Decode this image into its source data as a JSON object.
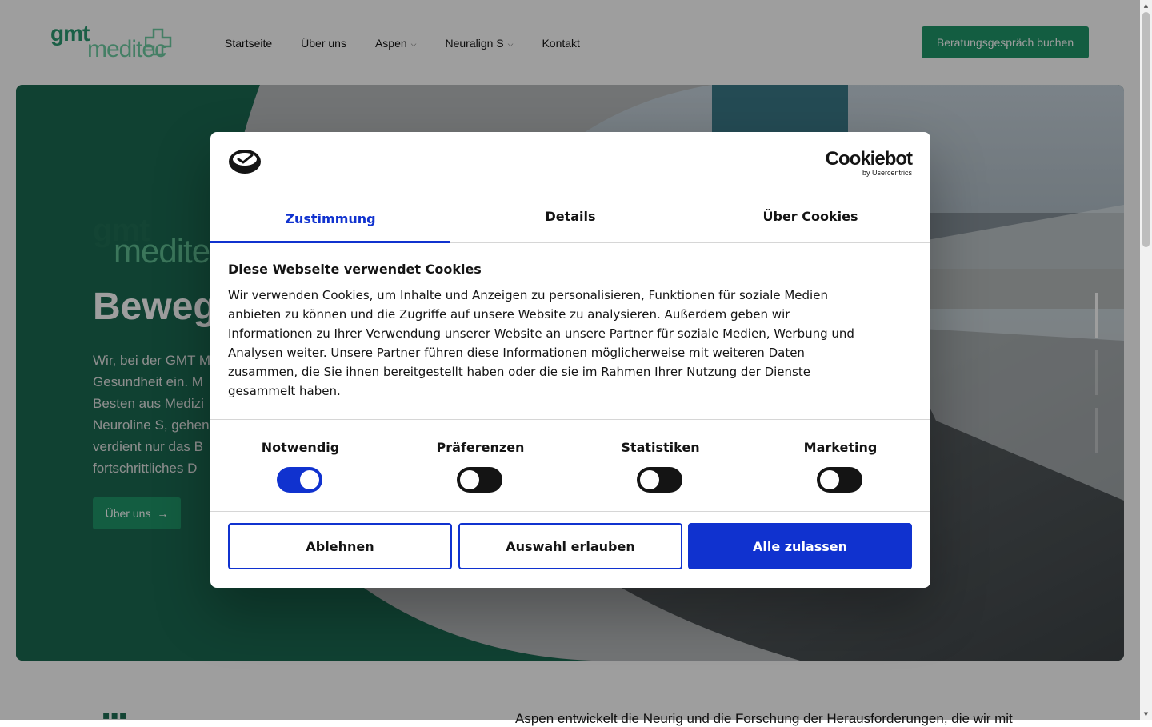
{
  "header": {
    "logo_word1": "gmt",
    "logo_word2": "meditec",
    "nav": [
      {
        "label": "Startseite"
      },
      {
        "label": "Über uns"
      },
      {
        "label": "Aspen",
        "dropdown": true
      },
      {
        "label": "Neuralign S",
        "dropdown": true
      },
      {
        "label": "Kontakt"
      }
    ],
    "cta_label": "Beratungsgespräch buchen"
  },
  "hero": {
    "logo_word1": "gmt",
    "logo_word2": "medite",
    "title": "Beweg",
    "text_lines": [
      "Wir, bei der GMT M",
      "Gesundheit ein. M",
      "Besten aus Medizi",
      "Neuroline S, gehen",
      "verdient nur das B",
      "fortschrittliches D"
    ],
    "button_label": "Über uns",
    "button_arrow": "→",
    "slides": 3,
    "active_slide": 1
  },
  "below": {
    "mark": "▪▪▪",
    "text": "Aspen entwickelt die Neurig und die Forschung der Herausforderungen, die wir mit"
  },
  "cookie_dialog": {
    "brand_name": "Cookiebot",
    "brand_sub": "by Usercentrics",
    "tabs": [
      {
        "label": "Zustimmung",
        "active": true
      },
      {
        "label": "Details",
        "active": false
      },
      {
        "label": "Über Cookies",
        "active": false
      }
    ],
    "heading": "Diese Webseite verwendet Cookies",
    "body_lines": [
      "Wir verwenden Cookies, um Inhalte und Anzeigen zu personalisieren, Funktionen für soziale Medien",
      "anbieten zu können und die Zugriffe auf unsere Website zu analysieren. Außerdem geben wir",
      "Informationen zu Ihrer Verwendung unserer Website an unsere Partner für soziale Medien, Werbung und",
      "Analysen weiter. Unsere Partner führen diese Informationen möglicherweise mit weiteren Daten",
      "zusammen, die Sie ihnen bereitgestellt haben oder die sie im Rahmen Ihrer Nutzung der Dienste",
      "gesammelt haben."
    ],
    "categories": [
      {
        "label": "Notwendig",
        "enabled": true
      },
      {
        "label": "Präferenzen",
        "enabled": false
      },
      {
        "label": "Statistiken",
        "enabled": false
      },
      {
        "label": "Marketing",
        "enabled": false
      }
    ],
    "buttons": {
      "decline": "Ablehnen",
      "allow_selection": "Auswahl erlauben",
      "allow_all": "Alle zulassen"
    }
  },
  "colors": {
    "brand_green": "#1f9669",
    "logo_green_light": "#6fcea4",
    "cookiebot_blue": "#1032cf",
    "hero_green": "#1a6a51"
  },
  "icons": {
    "nav_dropdown": "chevron-down-icon",
    "hero_button": "arrow-right-icon",
    "cookie_mark": "cookiebot-logo-icon"
  }
}
